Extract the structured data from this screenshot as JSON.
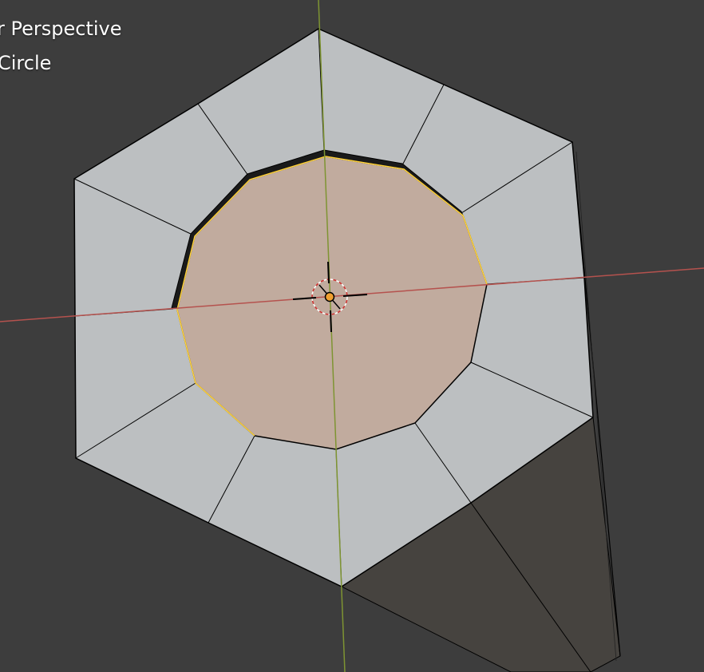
{
  "viewport": {
    "view_label": "r Perspective",
    "object_label": "Circle"
  },
  "colors": {
    "background": "#3d3d3d",
    "face": "#bcbfc1",
    "face_selected": "#c1ab9e",
    "side_shadow": "#46433f",
    "edge": "#000000",
    "edge_selected": "#ffd23a",
    "axis_x": "#b5524e",
    "axis_y": "#7e9432",
    "origin": "#f0a030"
  },
  "icons": {
    "cursor": "3d-cursor-icon",
    "origin": "object-origin-icon"
  }
}
